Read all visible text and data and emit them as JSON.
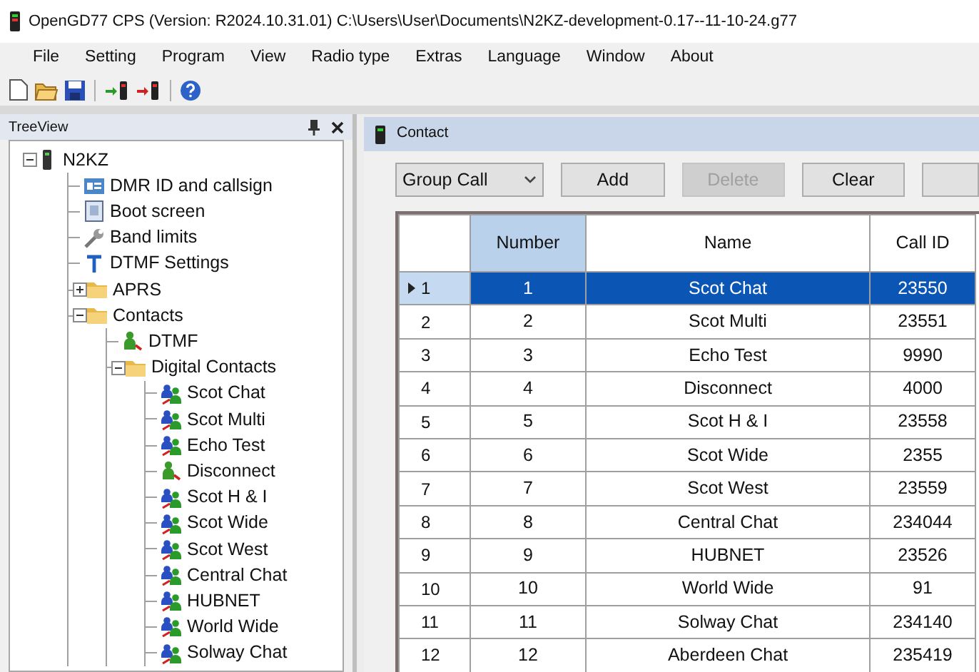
{
  "window": {
    "title": "OpenGD77 CPS (Version: R2024.10.31.01) C:\\Users\\User\\Documents\\N2KZ-development-0.17--11-10-24.g77"
  },
  "menu": [
    "File",
    "Setting",
    "Program",
    "View",
    "Radio type",
    "Extras",
    "Language",
    "Window",
    "About"
  ],
  "treeview": {
    "title": "TreeView",
    "items": [
      {
        "label": "N2KZ",
        "kind": "radio",
        "expanded": true,
        "children": [
          {
            "label": "DMR ID and callsign",
            "kind": "settings"
          },
          {
            "label": "Boot screen",
            "kind": "screen"
          },
          {
            "label": "Band limits",
            "kind": "wrench"
          },
          {
            "label": "DTMF Settings",
            "kind": "tone"
          },
          {
            "label": "APRS",
            "kind": "folder",
            "expanded": false
          },
          {
            "label": "Contacts",
            "kind": "folder",
            "expanded": true,
            "children": [
              {
                "label": "DTMF",
                "kind": "contact"
              },
              {
                "label": "Digital Contacts",
                "kind": "folder",
                "expanded": true,
                "children": [
                  {
                    "label": "Scot Chat",
                    "kind": "group"
                  },
                  {
                    "label": "Scot Multi",
                    "kind": "group"
                  },
                  {
                    "label": "Echo Test",
                    "kind": "group"
                  },
                  {
                    "label": "Disconnect",
                    "kind": "contact"
                  },
                  {
                    "label": "Scot H & I",
                    "kind": "group"
                  },
                  {
                    "label": "Scot Wide",
                    "kind": "group"
                  },
                  {
                    "label": "Scot West",
                    "kind": "group"
                  },
                  {
                    "label": "Central Chat",
                    "kind": "group"
                  },
                  {
                    "label": "HUBNET",
                    "kind": "group"
                  },
                  {
                    "label": "World Wide",
                    "kind": "group"
                  },
                  {
                    "label": "Solway Chat",
                    "kind": "group"
                  }
                ]
              }
            ]
          }
        ]
      }
    ]
  },
  "contact": {
    "title": "Contact",
    "call_type": "Group Call",
    "buttons": [
      {
        "label": "Add",
        "disabled": false
      },
      {
        "label": "Delete",
        "disabled": true
      },
      {
        "label": "Clear",
        "disabled": false
      }
    ],
    "columns": [
      {
        "label": "Number",
        "selected": true
      },
      {
        "label": "Name",
        "selected": false
      },
      {
        "label": "Call ID",
        "selected": false
      }
    ],
    "rows": [
      {
        "header": "1",
        "selected": true,
        "cells": [
          "1",
          "Scot Chat",
          "23550"
        ]
      },
      {
        "header": "2",
        "selected": false,
        "cells": [
          "2",
          "Scot Multi",
          "23551"
        ]
      },
      {
        "header": "3",
        "selected": false,
        "cells": [
          "3",
          "Echo Test",
          "9990"
        ]
      },
      {
        "header": "4",
        "selected": false,
        "cells": [
          "4",
          "Disconnect",
          "4000"
        ]
      },
      {
        "header": "5",
        "selected": false,
        "cells": [
          "5",
          "Scot H & I",
          "23558"
        ]
      },
      {
        "header": "6",
        "selected": false,
        "cells": [
          "6",
          "Scot Wide",
          "2355"
        ]
      },
      {
        "header": "7",
        "selected": false,
        "cells": [
          "7",
          "Scot West",
          "23559"
        ]
      },
      {
        "header": "8",
        "selected": false,
        "cells": [
          "8",
          "Central Chat",
          "234044"
        ]
      },
      {
        "header": "9",
        "selected": false,
        "cells": [
          "9",
          "HUBNET",
          "23526"
        ]
      },
      {
        "header": "10",
        "selected": false,
        "cells": [
          "10",
          "World Wide",
          "91"
        ]
      },
      {
        "header": "11",
        "selected": false,
        "cells": [
          "11",
          "Solway Chat",
          "234140"
        ]
      },
      {
        "header": "12",
        "selected": false,
        "cells": [
          "12",
          "Aberdeen Chat",
          "235419"
        ]
      }
    ]
  }
}
